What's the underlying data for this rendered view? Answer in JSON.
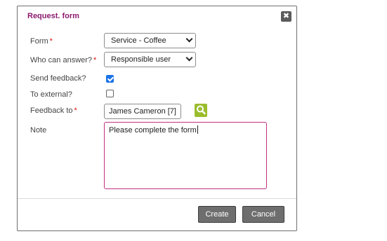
{
  "dialog": {
    "title": "Request. form",
    "close_glyph": "✖"
  },
  "fields": {
    "form": {
      "label": "Form",
      "required_mark": "*",
      "value": "Service - Coffee"
    },
    "who_can_answer": {
      "label": "Who can answer?",
      "required_mark": "*",
      "value": "Responsible user"
    },
    "send_feedback": {
      "label": "Send feedback?",
      "checked": true
    },
    "to_external": {
      "label": "To external?",
      "checked": false
    },
    "feedback_to": {
      "label": "Feedback to",
      "required_mark": "*",
      "value": "James Cameron [7]"
    },
    "note": {
      "label": "Note",
      "value": "Please complete the form"
    }
  },
  "buttons": {
    "create": "Create",
    "cancel": "Cancel"
  },
  "colors": {
    "title": "#8b1a6e",
    "required": "#d11111",
    "checkbox_checked": "#1a73e8",
    "search_button": "#9bbd2d",
    "note_border": "#c0307f",
    "button_bg": "#6e6e6e"
  },
  "icons": {
    "close": "close-icon",
    "search": "search-icon",
    "dropdown": "chevron-down-icon",
    "check": "checkmark-icon"
  }
}
